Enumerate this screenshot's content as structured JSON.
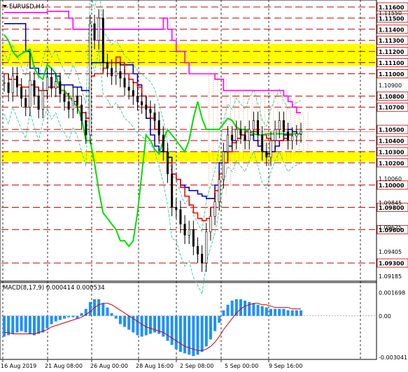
{
  "chart_data": [
    {
      "type": "line",
      "panel": "price",
      "title": "EURUSD,H4",
      "ylim": [
        1.0915,
        1.1165
      ],
      "price_labels_bold": [
        "1.11600",
        "1.11500",
        "1.11400",
        "1.11300",
        "1.11200",
        "1.11100",
        "1.11000",
        "1.10800",
        "1.10700",
        "1.10500",
        "1.10400",
        "1.10300",
        "1.10200",
        "1.10000",
        "1.09800",
        "1.09600",
        "1.09300"
      ],
      "price_labels_plain": [
        "1.11550",
        "1.10900",
        "1.10060",
        "1.09845",
        "1.09625",
        "1.09405",
        "1.09185"
      ],
      "hlines": [
        1.116,
        1.115,
        1.114,
        1.113,
        1.112,
        1.111,
        1.11,
        1.108,
        1.107,
        1.105,
        1.104,
        1.103,
        1.102,
        1.1,
        1.098,
        1.096,
        1.093
      ],
      "resistance_zone": [
        1.1107,
        1.1127
      ],
      "support_zone": [
        1.1021,
        1.103
      ],
      "current_price": 1.1048,
      "candles_close": [
        1.1092,
        1.1083,
        1.1098,
        1.1088,
        1.1078,
        1.107,
        1.1094,
        1.108,
        1.1068,
        1.1085,
        1.1097,
        1.1087,
        1.1093,
        1.1082,
        1.1075,
        1.1068,
        1.108,
        1.1072,
        1.1058,
        1.1045,
        1.1145,
        1.113,
        1.115,
        1.111,
        1.1105,
        1.1098,
        1.1102,
        1.1096,
        1.1088,
        1.1085,
        1.108,
        1.1075,
        1.1072,
        1.1068,
        1.1065,
        1.1058,
        1.1045,
        1.103,
        1.101,
        1.098,
        1.0978,
        1.0965,
        1.0955,
        1.096,
        1.0945,
        1.0938,
        1.093,
        1.0958,
        1.0972,
        1.0985,
        1.1005,
        1.103,
        1.1045,
        1.104,
        1.105,
        1.1045,
        1.104,
        1.105,
        1.1058,
        1.1045,
        1.103,
        1.1025,
        1.104,
        1.105,
        1.1058,
        1.1048,
        1.104,
        1.1044,
        1.1046,
        1.1048
      ],
      "series": [
        {
          "name": "",
          "color": "#ff00ff",
          "values": [
            1.1155,
            1.1155,
            1.1155,
            1.1155,
            1.1155,
            1.1155,
            1.1155,
            1.1155,
            1.1155,
            1.1155,
            1.1156,
            1.1156,
            1.1156,
            1.1156,
            1.1156,
            1.115,
            1.114,
            1.114,
            1.114,
            1.114,
            1.114,
            1.114,
            1.114,
            1.114,
            1.114,
            1.114,
            1.114,
            1.114,
            1.114,
            1.114,
            1.114,
            1.114,
            1.114,
            1.114,
            1.114,
            1.114,
            1.114,
            1.115,
            1.114,
            1.113,
            1.112,
            1.112,
            1.111,
            1.11,
            1.11,
            1.11,
            1.11,
            1.11,
            1.11,
            1.1095,
            1.1095,
            1.1085,
            1.1085,
            1.1085,
            1.1085,
            1.1085,
            1.1085,
            1.1085,
            1.1085,
            1.1085,
            1.1085,
            1.1085,
            1.1085,
            1.1085,
            1.1085,
            1.108,
            1.1075,
            1.107,
            1.1065,
            1.1065
          ]
        },
        {
          "name": "",
          "color": "#0000cc",
          "values": [
            1.1145,
            1.1145,
            1.1145,
            1.1145,
            1.1145,
            1.112,
            1.1105,
            1.1105,
            1.11,
            1.11,
            1.11,
            1.11,
            1.1098,
            1.109,
            1.109,
            1.109,
            1.1088,
            1.1088,
            1.1085,
            1.1085,
            1.111,
            1.111,
            1.111,
            1.111,
            1.111,
            1.111,
            1.111,
            1.1108,
            1.1108,
            1.1108,
            1.11,
            1.109,
            1.108,
            1.106,
            1.1045,
            1.1035,
            1.103,
            1.103,
            1.1025,
            1.101,
            1.1005,
            1.1,
            1.0998,
            1.0995,
            1.0995,
            1.0992,
            1.099,
            1.0988,
            1.0988,
            1.1,
            1.102,
            1.103,
            1.1035,
            1.104,
            1.1042,
            1.1045,
            1.1048,
            1.1045,
            1.104,
            1.1035,
            1.103,
            1.1028,
            1.103,
            1.1035,
            1.104,
            1.1045,
            1.105,
            1.1048,
            1.1046,
            1.1045
          ]
        },
        {
          "name": "",
          "color": "#ff0000",
          "values": [
            1.11,
            1.1095,
            1.1095,
            1.109,
            1.1088,
            1.1088,
            1.109,
            1.1088,
            1.1085,
            1.1085,
            1.1088,
            1.1088,
            1.1088,
            1.1085,
            1.1082,
            1.1078,
            1.1075,
            1.107,
            1.1065,
            1.106,
            1.1098,
            1.11,
            1.11,
            1.1105,
            1.111,
            1.111,
            1.1115,
            1.111,
            1.11,
            1.1095,
            1.1092,
            1.1088,
            1.108,
            1.107,
            1.106,
            1.105,
            1.104,
            1.103,
            1.102,
            1.101,
            1.1005,
            1.0998,
            1.099,
            1.0982,
            1.0975,
            1.097,
            1.0968,
            1.097,
            1.098,
            1.0995,
            1.101,
            1.102,
            1.103,
            1.1038,
            1.1042,
            1.1045,
            1.1048,
            1.1048,
            1.1048,
            1.1045,
            1.1045,
            1.1042,
            1.104,
            1.104,
            1.104,
            1.1042,
            1.1045,
            1.1046,
            1.1046,
            1.1046
          ]
        },
        {
          "name": "",
          "color": "#00dd00",
          "values": [
            1.1135,
            1.113,
            1.112,
            1.1115,
            1.1118,
            1.112,
            1.1122,
            1.1105,
            1.1098,
            1.1095,
            1.1108,
            1.1105,
            1.11,
            1.1085,
            1.1085,
            1.108,
            1.1075,
            1.107,
            1.106,
            1.104,
            1.104,
            1.102,
            1.0995,
            1.0975,
            1.097,
            1.0965,
            1.096,
            1.095,
            1.095,
            1.0945,
            1.095,
            1.0975,
            1.101,
            1.1045,
            1.104,
            1.1032,
            1.1028,
            1.104,
            1.105,
            1.1045,
            1.104,
            1.1035,
            1.103,
            1.104,
            1.106,
            1.1075,
            1.106,
            1.105,
            1.105,
            1.105,
            1.105,
            1.1055,
            1.106,
            1.1058,
            1.1052,
            1.105,
            1.105,
            1.1048,
            1.1046,
            1.1045,
            1.1045,
            1.1046,
            1.1046,
            1.1046,
            1.1046,
            1.1046,
            1.1046,
            1.1046,
            1.1046,
            1.1046
          ]
        }
      ],
      "bands_color": "#33cc99",
      "cloud_color": "#e08040"
    },
    {
      "type": "bar",
      "panel": "macd",
      "title": "MACD(8,17,9) 0.000414 0.000534",
      "ylim": [
        -0.003041,
        0.001698
      ],
      "ytick_labels": [
        "0.001698",
        "0.00",
        "-0.003041"
      ],
      "zero_line": 0,
      "histogram_color": "#1e90ff",
      "signal_color": "#cc0000",
      "histogram": [
        -0.0015,
        -0.0014,
        -0.0013,
        -0.0012,
        -0.0011,
        -0.0012,
        -0.0013,
        -0.0014,
        -0.0013,
        -0.0012,
        -0.0009,
        -0.0006,
        -0.0004,
        -0.0003,
        -0.0002,
        -0.0001,
        -0.0001,
        -0.0002,
        0.0002,
        0.0005,
        0.001,
        0.0012,
        0.0012,
        0.0009,
        0.0006,
        0.0002,
        -0.0002,
        -0.0006,
        -0.0008,
        -0.001,
        -0.0012,
        -0.0014,
        -0.0015,
        -0.0014,
        -0.0013,
        -0.0012,
        -0.0013,
        -0.0015,
        -0.0018,
        -0.0021,
        -0.0024,
        -0.0026,
        -0.0027,
        -0.0028,
        -0.0029,
        -0.0028,
        -0.0026,
        -0.0022,
        -0.0017,
        -0.0011,
        -0.0005,
        0.0004,
        0.0008,
        0.0011,
        0.0012,
        0.0012,
        0.0011,
        0.001,
        0.0009,
        0.0008,
        0.0007,
        0.0006,
        0.0005,
        0.0005,
        0.0005,
        0.0005,
        0.0004,
        0.0004,
        0.0004,
        0.0004
      ],
      "signal": [
        -0.0012,
        -0.0012,
        -0.0013,
        -0.0013,
        -0.0013,
        -0.0013,
        -0.0013,
        -0.0013,
        -0.0012,
        -0.0011,
        -0.001,
        -0.0008,
        -0.0007,
        -0.0006,
        -0.0005,
        -0.0004,
        -0.0003,
        -0.0002,
        -0.0001,
        0.0001,
        0.0003,
        0.0006,
        0.0008,
        0.0009,
        0.0009,
        0.0008,
        0.0006,
        0.0004,
        0.0002,
        0.0,
        -0.0002,
        -0.0004,
        -0.0006,
        -0.0008,
        -0.0009,
        -0.001,
        -0.0011,
        -0.0012,
        -0.0014,
        -0.0016,
        -0.0018,
        -0.002,
        -0.0022,
        -0.0023,
        -0.0024,
        -0.0025,
        -0.0025,
        -0.0024,
        -0.0022,
        -0.0019,
        -0.0015,
        -0.001,
        -0.0006,
        -0.0002,
        0.0002,
        0.0005,
        0.0007,
        0.0008,
        0.0009,
        0.0009,
        0.0008,
        0.0008,
        0.0007,
        0.0006,
        0.0006,
        0.0006,
        0.0006,
        0.0005,
        0.0005,
        0.0005
      ]
    }
  ],
  "x_axis": {
    "labels": [
      "16 Aug 2019",
      "21 Aug 08:00",
      "26 Aug 00:00",
      "28 Aug 16:00",
      "2 Sep 08:00",
      "5 Sep 00:00",
      "9 Sep 16:00"
    ]
  },
  "colors": {
    "hline": "#cc0000",
    "zone": "#ffff00",
    "vline": "#000000",
    "axis_text": "#000000"
  }
}
